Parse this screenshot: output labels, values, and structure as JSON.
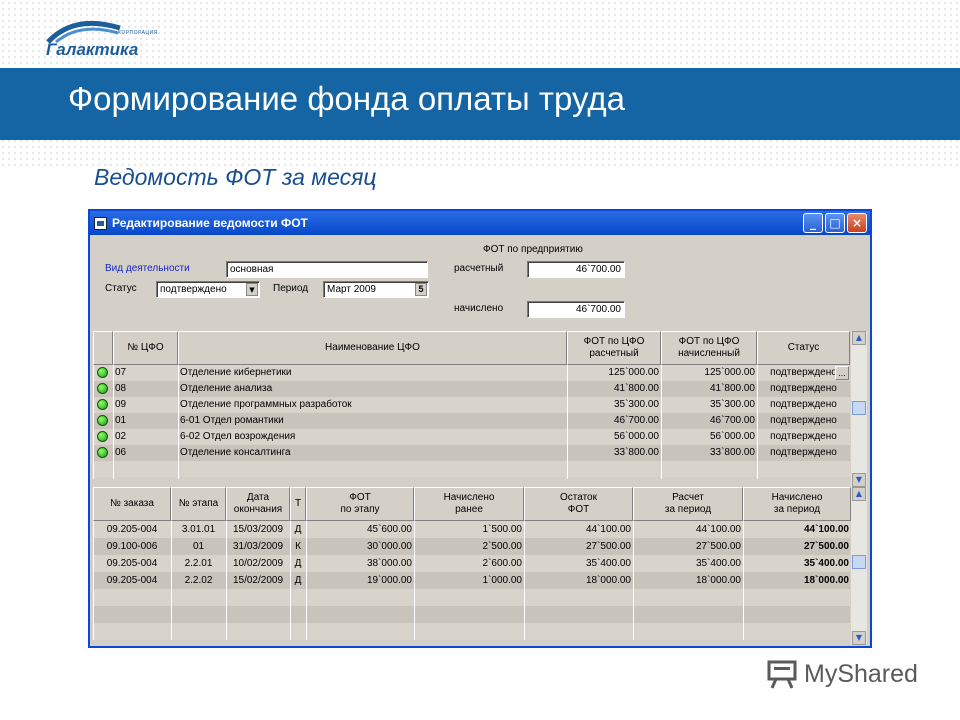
{
  "logo": {
    "small": "КОРПОРАЦИЯ",
    "name": "Галактика"
  },
  "slide_title": "Формирование фонда оплаты труда",
  "subtitle": "Ведомость ФОТ за месяц",
  "window": {
    "title": "Редактирование ведомости ФОТ",
    "fields": {
      "activity_label": "Вид деятельности",
      "activity_value": "основная",
      "status_label": "Статус",
      "status_value": "подтверждено",
      "period_label": "Период",
      "period_value": "Март 2009",
      "period_btn": "5",
      "fot_enterprise_label": "ФОТ по предприятию",
      "calc_label": "расчетный",
      "calc_value": "46`700.00",
      "accrued_label": "начислено",
      "accrued_value": "46`700.00"
    },
    "top_table": {
      "headers": [
        "№ ЦФО",
        "Наименование ЦФО",
        "ФОТ по ЦФО\nрасчетный",
        "ФОТ по ЦФО\nначисленный",
        "Статус"
      ],
      "rows": [
        {
          "code": "07",
          "name": "Отделение кибернетики",
          "calc": "125`000.00",
          "accrued": "125`000.00",
          "status": "подтверждено",
          "extra": "..."
        },
        {
          "code": "08",
          "name": "Отделение анализа",
          "calc": "41`800.00",
          "accrued": "41`800.00",
          "status": "подтверждено"
        },
        {
          "code": "09",
          "name": "Отделение программных разработок",
          "calc": "35`300.00",
          "accrued": "35`300.00",
          "status": "подтверждено"
        },
        {
          "code": "01",
          "name": "6-01 Отдел романтики",
          "calc": "46`700.00",
          "accrued": "46`700.00",
          "status": "подтверждено"
        },
        {
          "code": "02",
          "name": "6-02 Отдел возрождения",
          "calc": "56`000.00",
          "accrued": "56`000.00",
          "status": "подтверждено"
        },
        {
          "code": "06",
          "name": "Отделение консалтинга",
          "calc": "33`800.00",
          "accrued": "33`800.00",
          "status": "подтверждено"
        }
      ]
    },
    "bottom_table": {
      "headers": [
        "№ заказа",
        "№ этапа",
        "Дата\nокончания",
        "Т",
        "ФОТ\nпо этапу",
        "Начислено\nранее",
        "Остаток\nФОТ",
        "Расчет\nза период",
        "Начислено\nза период"
      ],
      "rows": [
        [
          "09.205-004",
          "3.01.01",
          "15/03/2009",
          "Д",
          "45`600.00",
          "1`500.00",
          "44`100.00",
          "44`100.00",
          "44`100.00"
        ],
        [
          "09.100-006",
          "01",
          "31/03/2009",
          "К",
          "30`000.00",
          "2`500.00",
          "27`500.00",
          "27`500.00",
          "27`500.00"
        ],
        [
          "09.205-004",
          "2.2.01",
          "10/02/2009",
          "Д",
          "38`000.00",
          "2`600.00",
          "35`400.00",
          "35`400.00",
          "35`400.00"
        ],
        [
          "09.205-004",
          "2.2.02",
          "15/02/2009",
          "Д",
          "19`000.00",
          "1`000.00",
          "18`000.00",
          "18`000.00",
          "18`000.00"
        ]
      ]
    }
  },
  "watermark": "MyShared"
}
